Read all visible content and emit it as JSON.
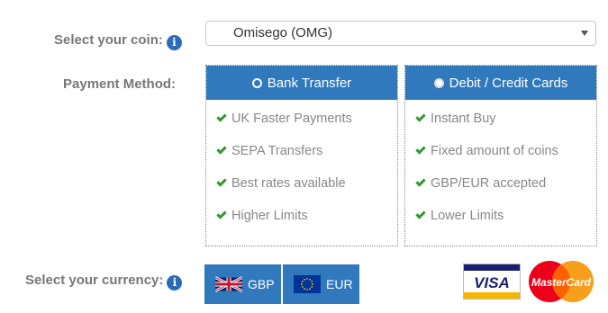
{
  "coin": {
    "label": "Select your coin:",
    "selected": "Omisego (OMG)"
  },
  "payment": {
    "label": "Payment Method:",
    "options": [
      {
        "title": "Bank Transfer",
        "selected": true,
        "features": [
          "UK Faster Payments",
          "SEPA Transfers",
          "Best rates available",
          "Higher Limits"
        ]
      },
      {
        "title": "Debit / Credit Cards",
        "selected": false,
        "features": [
          "Instant Buy",
          "Fixed amount of coins",
          "GBP/EUR accepted",
          "Lower Limits"
        ]
      }
    ]
  },
  "currency": {
    "label": "Select your currency:",
    "options": [
      "GBP",
      "EUR"
    ]
  },
  "cards": {
    "visa": "VISA",
    "mastercard": "MasterCard"
  },
  "colors": {
    "accent": "#3079bd",
    "check": "#2e9a2e",
    "info": "#2b6cb8"
  }
}
